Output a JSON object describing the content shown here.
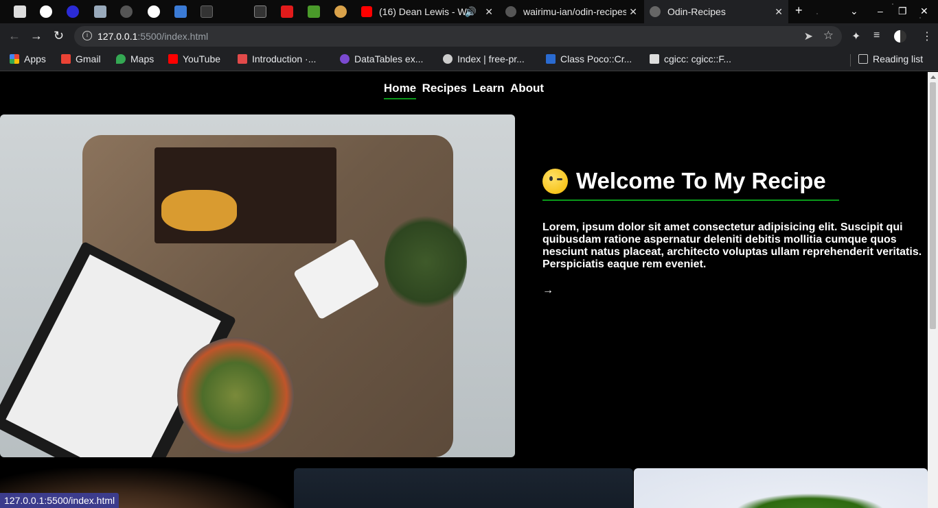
{
  "browser": {
    "tabs": [
      {
        "title": "(16) Dean Lewis - W"
      },
      {
        "title": "wairimu-ian/odin-recipes"
      },
      {
        "title": "Odin-Recipes"
      }
    ],
    "url_host": "127.0.0.1",
    "url_path": ":5500/index.html",
    "status_url": "127.0.0.1:5500/index.html",
    "bookmarks": [
      {
        "label": "Apps",
        "icon": "apps-grid-icon",
        "color": "#4285f4"
      },
      {
        "label": "Gmail",
        "icon": "gmail-icon",
        "color": "#ea4335"
      },
      {
        "label": "Maps",
        "icon": "maps-pin-icon",
        "color": "#34a853"
      },
      {
        "label": "YouTube",
        "icon": "youtube-icon",
        "color": "#ff0000"
      },
      {
        "label": "Introduction ·...",
        "icon": "bookmark-icon",
        "color": "#e24a4a"
      },
      {
        "label": "DataTables ex...",
        "icon": "datatables-icon",
        "color": "#7b4ad1"
      },
      {
        "label": "Index | free-pr...",
        "icon": "globe-icon",
        "color": "#cccccc"
      },
      {
        "label": "Class Poco::Cr...",
        "icon": "poco-icon",
        "color": "#2a6bd1"
      },
      {
        "label": "cgicc: cgicc::F...",
        "icon": "cgicc-icon",
        "color": "#dddddd"
      }
    ],
    "reading_list": "Reading list"
  },
  "site": {
    "nav": [
      {
        "label": "Home"
      },
      {
        "label": "Recipes"
      },
      {
        "label": "Learn"
      },
      {
        "label": "About"
      }
    ],
    "hero": {
      "title": "Welcome To My Recipe",
      "body": "Lorem, ipsum dolor sit amet consectetur adipisicing elit. Suscipit qui quibusdam ratione aspernatur deleniti debitis mollitia cumque quos nesciunt natus placeat, architecto voluptas ullam reprehenderit veritatis. Perspiciatis eaque rem eveniet.",
      "arrow": "→"
    }
  },
  "colors": {
    "accent": "#0a9a1a",
    "page_bg": "#000000",
    "status_bg": "#3c3c8c"
  }
}
